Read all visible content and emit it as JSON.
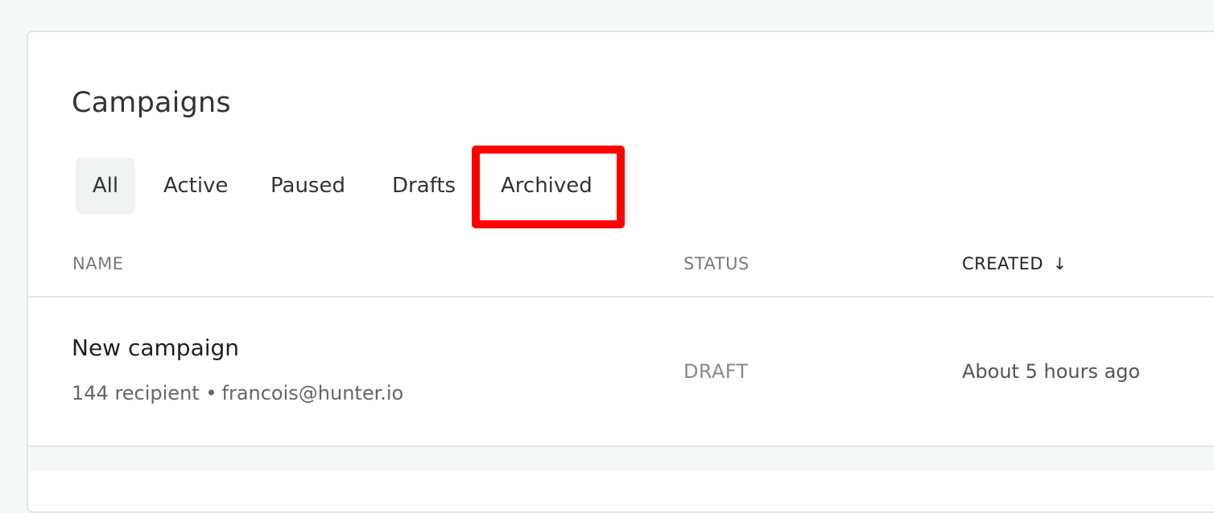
{
  "page": {
    "title": "Campaigns"
  },
  "tabs": [
    {
      "label": "All",
      "selected": true
    },
    {
      "label": "Active",
      "selected": false
    },
    {
      "label": "Paused",
      "selected": false
    },
    {
      "label": "Drafts",
      "selected": false
    },
    {
      "label": "Archived",
      "selected": false,
      "highlighted": true
    }
  ],
  "table": {
    "columns": [
      {
        "label": "NAME"
      },
      {
        "label": "STATUS"
      },
      {
        "label": "CREATED",
        "sorted": "desc",
        "sort_icon": "arrow-down-icon",
        "sort_glyph": "↓"
      }
    ],
    "rows": [
      {
        "name": "New campaign",
        "recipients": "144 recipient",
        "separator": "•",
        "sender": "francois@hunter.io",
        "subtitle": "144 recipient • francois@hunter.io",
        "status": "DRAFT",
        "created": "About 5 hours ago"
      }
    ]
  },
  "colors": {
    "highlight": "#ff0000",
    "background": "#f7f8f8",
    "card": "#ffffff",
    "selected_tab_bg": "#f1f2f2"
  }
}
